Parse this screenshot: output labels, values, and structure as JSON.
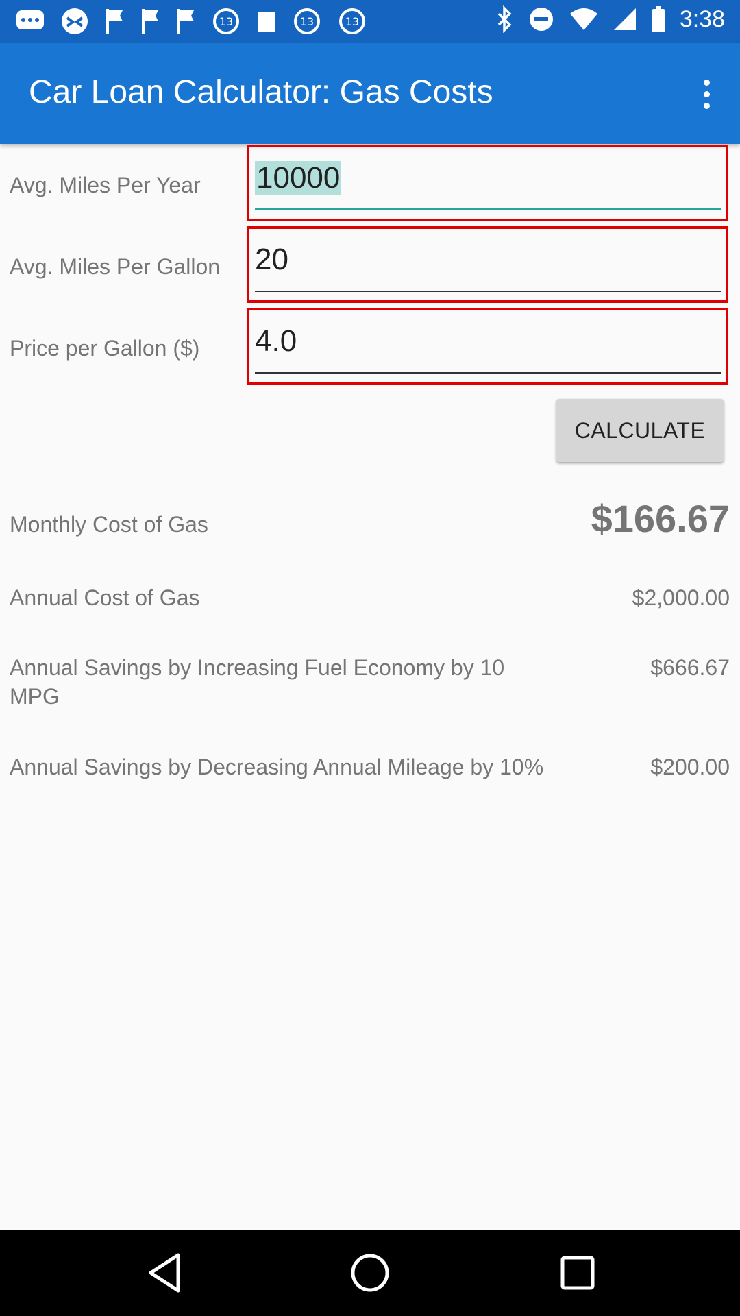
{
  "status_bar": {
    "time": "3:38",
    "icons": [
      "messages-icon",
      "game-controller-icon",
      "flag-icon",
      "flag-icon",
      "flag-icon",
      "news-13-icon",
      "square-icon",
      "news-13-icon",
      "news-13-icon",
      "bluetooth-icon",
      "do-not-disturb-icon",
      "wifi-icon",
      "cellular-signal-icon",
      "battery-icon"
    ]
  },
  "app_bar": {
    "title": "Car Loan Calculator: Gas Costs",
    "menu_icon": "more-vert-icon"
  },
  "form": {
    "miles_per_year": {
      "label": "Avg. Miles Per Year",
      "value": "10000"
    },
    "miles_per_gallon": {
      "label": "Avg. Miles Per Gallon",
      "value": "20"
    },
    "price_per_gallon": {
      "label": "Price per Gallon ($)",
      "value": "4.0"
    },
    "calculate_label": "CALCULATE"
  },
  "results": {
    "monthly": {
      "label": "Monthly Cost of Gas",
      "value": "$166.67"
    },
    "annual": {
      "label": "Annual Cost of Gas",
      "value": "$2,000.00"
    },
    "savings_economy": {
      "label": "Annual Savings by Increasing Fuel Economy by 10 MPG",
      "value": "$666.67"
    },
    "savings_mileage": {
      "label": "Annual Savings by Decreasing Annual Mileage by 10%",
      "value": "$200.00"
    }
  },
  "nav_bar": {
    "icons": [
      "back-icon",
      "home-icon",
      "recents-icon"
    ]
  },
  "colors": {
    "status_bar": "#1565c0",
    "app_bar": "#1976d2",
    "highlight_border": "#e10000",
    "focus_underline": "#26a69a"
  }
}
